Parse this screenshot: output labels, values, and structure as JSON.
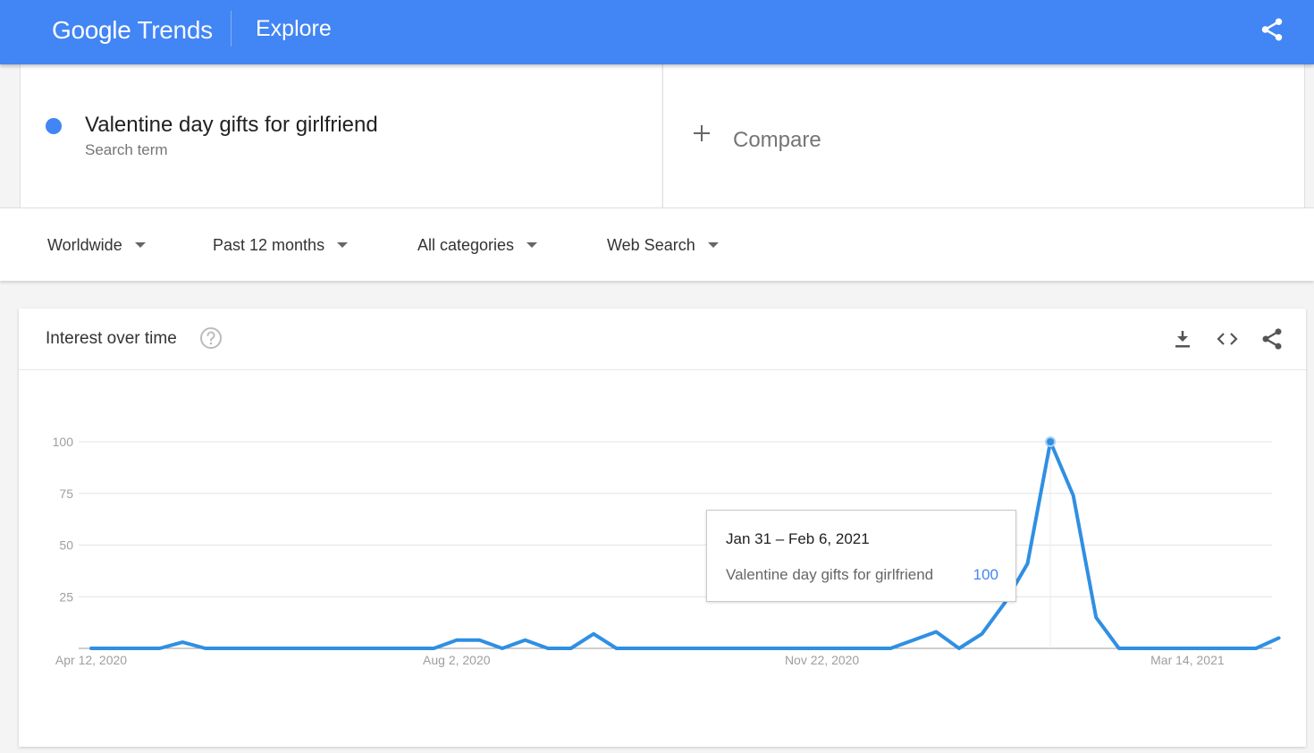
{
  "header": {
    "logo_brand": "Google",
    "logo_product": "Trends",
    "page_title": "Explore"
  },
  "search_term": {
    "title": "Valentine day gifts for girlfriend",
    "subtitle": "Search term",
    "color": "#4285f4"
  },
  "compare": {
    "label": "Compare"
  },
  "filters": {
    "region": "Worldwide",
    "time": "Past 12 months",
    "category": "All categories",
    "search_type": "Web Search"
  },
  "panel": {
    "title": "Interest over time"
  },
  "tooltip": {
    "date": "Jan 31 – Feb 6, 2021",
    "term": "Valentine day gifts for girlfriend",
    "value": "100"
  },
  "chart_data": {
    "type": "line",
    "line_color": "#2f8fe3",
    "grid": true,
    "ylim": [
      0,
      100
    ],
    "y_ticks": [
      100,
      75,
      50,
      25
    ],
    "x_ticks": [
      {
        "label": "Apr 12, 2020",
        "index": 0
      },
      {
        "label": "Aug 2, 2020",
        "index": 16
      },
      {
        "label": "Nov 22, 2020",
        "index": 32
      },
      {
        "label": "Mar 14, 2021",
        "index": 48
      }
    ],
    "highlight_index": 42,
    "series": [
      {
        "values": [
          0,
          0,
          0,
          0,
          3,
          0,
          0,
          0,
          0,
          0,
          0,
          0,
          0,
          0,
          0,
          0,
          4,
          4,
          0,
          4,
          0,
          0,
          7,
          0,
          0,
          0,
          0,
          0,
          0,
          0,
          0,
          0,
          0,
          0,
          0,
          0,
          4,
          8,
          0,
          7,
          22,
          41,
          100,
          74,
          15,
          0,
          0,
          0,
          0,
          0,
          0,
          0,
          5
        ]
      }
    ]
  }
}
